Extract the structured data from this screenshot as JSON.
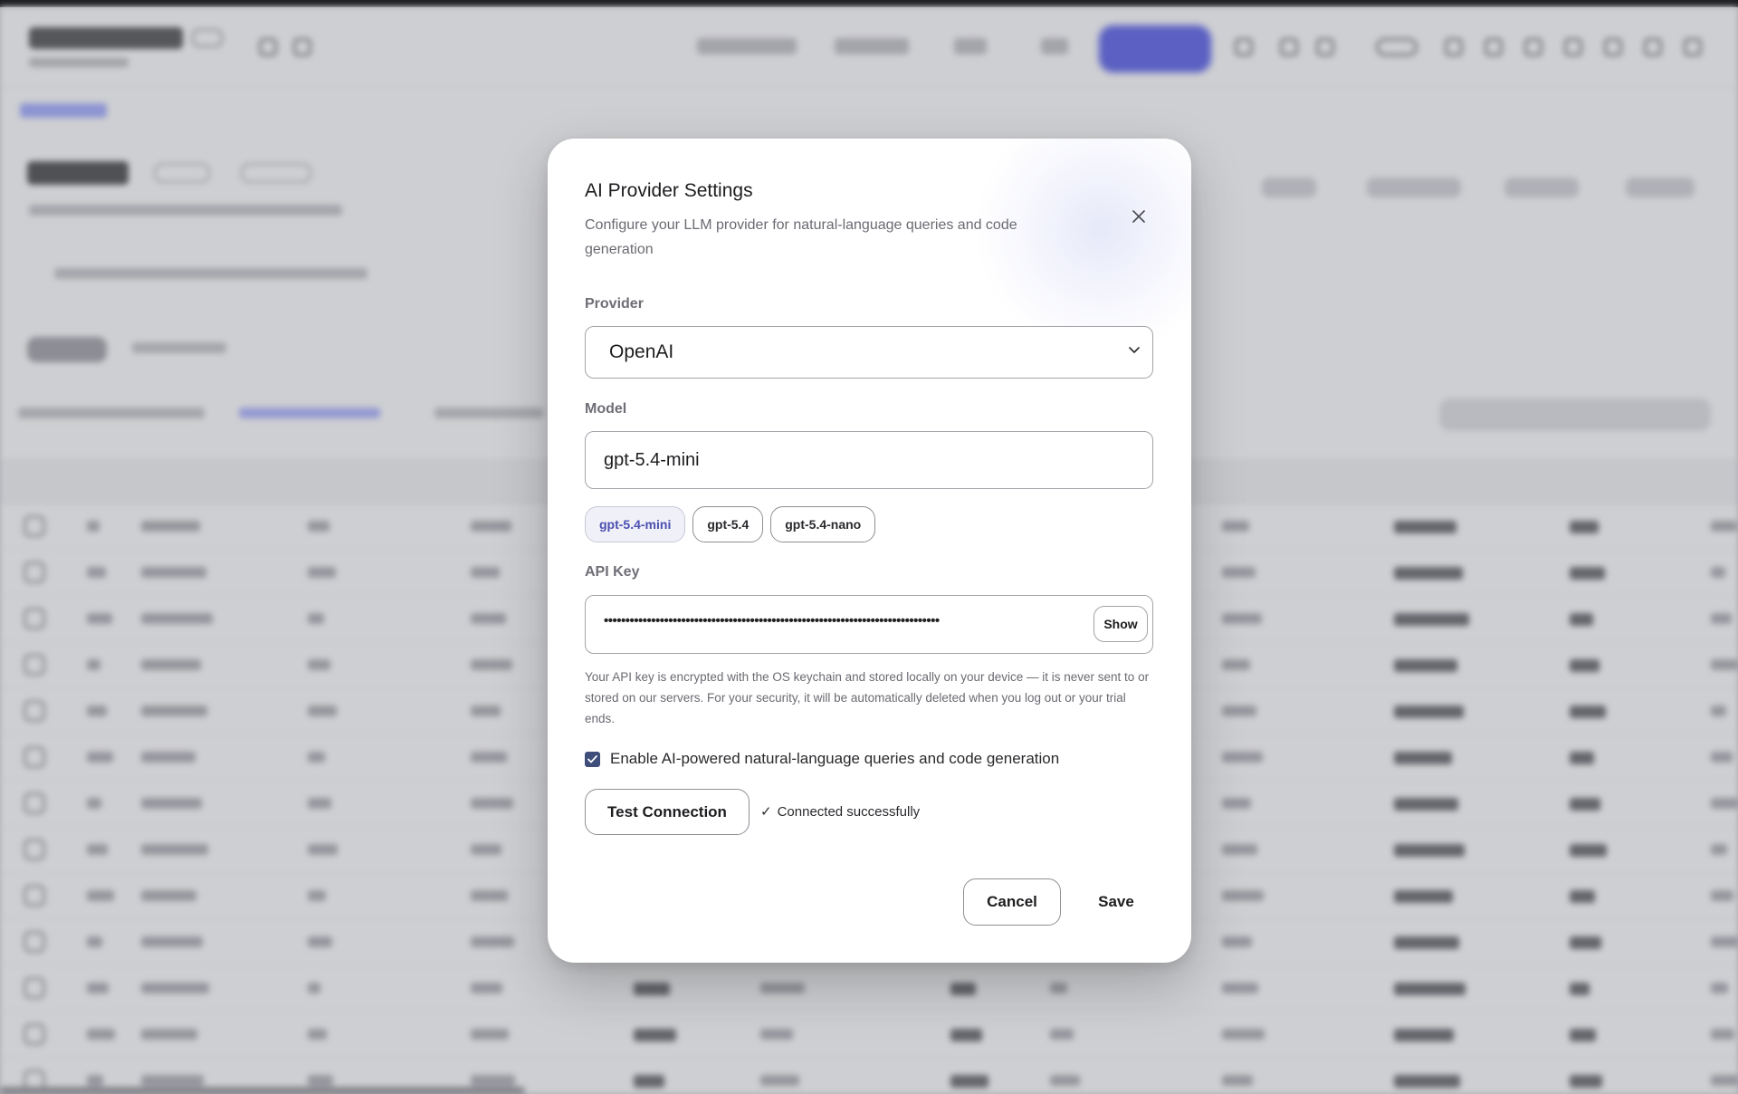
{
  "dialog": {
    "title": "AI Provider Settings",
    "description": "Configure your LLM provider for natural-language queries and code generation",
    "close_icon": "close-icon"
  },
  "provider": {
    "label": "Provider",
    "selected": "OpenAI"
  },
  "model": {
    "label": "Model",
    "value": "gpt-5.4-mini",
    "suggestions": [
      "gpt-5.4-mini",
      "gpt-5.4",
      "gpt-5.4-nano"
    ],
    "active_suggestion": "gpt-5.4-mini"
  },
  "api_key": {
    "label": "API Key",
    "masked_value": "••••••••••••••••••••••••••••••••••••••••••••••••••••••••••••••••••••••••••••••",
    "show_label": "Show",
    "note": "Your API key is encrypted with the OS keychain and stored locally on your device — it is never sent to or stored on our servers. For your security, it will be automatically deleted when you log out or your trial ends."
  },
  "enable_ai": {
    "checked": true,
    "label": "Enable AI-powered natural-language queries and code generation"
  },
  "test": {
    "button_label": "Test Connection",
    "status_icon": "✓",
    "status_text": "Connected successfully"
  },
  "footer": {
    "cancel_label": "Cancel",
    "save_label": "Save"
  },
  "colors": {
    "checkbox": "#3e4d7a",
    "active_chip_text": "#4a4fb0",
    "backdrop_accent": "#4b52e6"
  }
}
